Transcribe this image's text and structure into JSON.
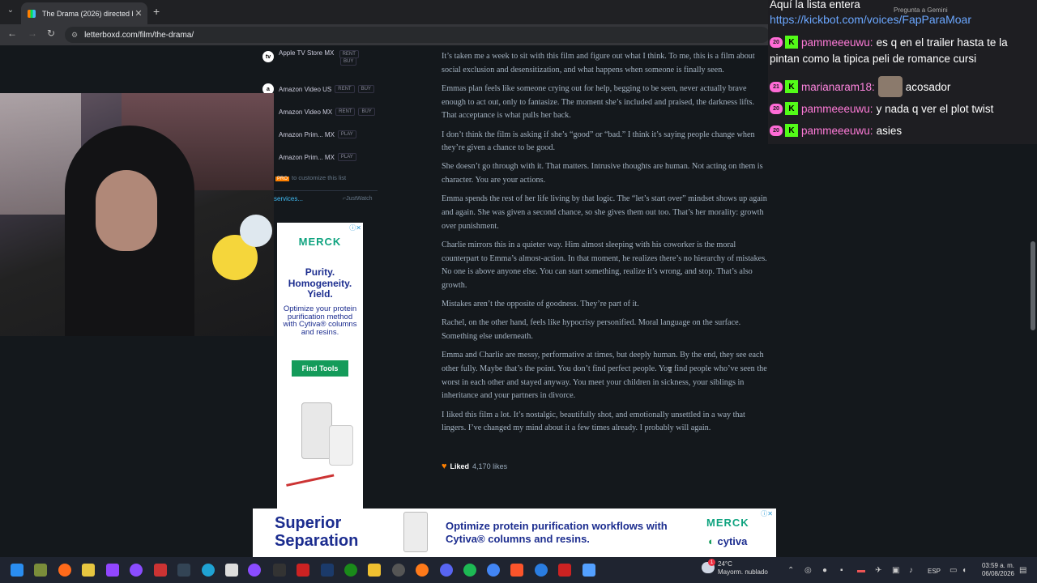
{
  "browser": {
    "tab_title": "The Drama (2026) directed by K",
    "tab_close": "✕",
    "new_tab": "+",
    "url": "letterboxd.com/film/the-drama/"
  },
  "where_to_watch": {
    "services": [
      {
        "name": "Apple TV Store MX",
        "icon": "tv",
        "badges": [
          "RENT",
          "BUY"
        ]
      },
      {
        "name": "Amazon Video US",
        "icon": "a",
        "badges": [
          "RENT",
          "BUY"
        ]
      },
      {
        "name": "Amazon Video MX",
        "icon": "a",
        "badges": [
          "RENT",
          "BUY"
        ]
      },
      {
        "name": "Amazon Prim... MX",
        "icon": "p",
        "badges": [
          "PLAY"
        ]
      },
      {
        "name": "Amazon Prim... MX",
        "icon": "p",
        "badges": [
          "PLAY"
        ]
      }
    ],
    "pro_badge": "PRO",
    "customize": "to customize this list",
    "services_link": "services...",
    "justwatch": "⌐JustWatch"
  },
  "review": {
    "paragraphs": [
      "It’s taken me a week to sit with this film and figure out what I think. To me, this is a film about social exclusion and desensitization, and what happens when someone is finally seen.",
      "Emmas plan feels like someone crying out for help, begging to be seen, never actually brave enough to act out, only to fantasize. The moment she’s included and praised, the darkness lifts. That acceptance is what pulls her back.",
      "I don’t think the film is asking if she’s “good” or “bad.” I think it’s saying people change when they’re given a chance to be good.",
      "She doesn’t go through with it. That matters. Intrusive thoughts are human. Not acting on them is character. You are your actions.",
      "Emma spends the rest of her life living by that logic. The “let’s start over” mindset shows up again and again. She was given a second chance, so she gives them out too. That’s her morality: growth over punishment.",
      "Charlie mirrors this in a quieter way. Him almost sleeping with his coworker is the moral counterpart to Emma’s almost-action. In that moment, he realizes there’s no hierarchy of mistakes. No one is above anyone else. You can start something, realize it’s wrong, and stop. That’s also growth.",
      "Mistakes aren’t the opposite of goodness. They’re part of it.",
      "Rachel, on the other hand, feels like hypocrisy personified. Moral language on the surface. Something else underneath.",
      "Emma and Charlie are messy, performative at times, but deeply human. By the end, they see each other fully. Maybe that’s the point. You don’t find perfect people. You find people who’ve seen the worst in each other and stayed anyway. You meet your children in sickness, your siblings in inheritance and your partners in divorce.",
      "I liked this film a lot. It’s nostalgic, beautifully shot, and emotionally unsettled in a way that lingers. I’ve changed my mind about it a few times already. I probably will again."
    ],
    "liked_label": "Liked",
    "likes_count": "4,170 likes"
  },
  "ad_vertical": {
    "brand": "MERCK",
    "headline": "Purity. Homogeneity. Yield.",
    "body": "Optimize your protein purification method with Cytiva® columns and resins.",
    "cta": "Find Tools"
  },
  "ad_banner": {
    "headline": "Superior Separation",
    "body": "Optimize protein purification workflows with Cytiva® columns and resins.",
    "brand": "MERCK",
    "brand2": "cytiva"
  },
  "chat": {
    "header": "Aquí la lista entera",
    "link": "https://kickbot.com/voices/FapParaMoar",
    "gemini": "Pregunta a Gemini",
    "messages": [
      {
        "level": "20",
        "user": "pammeeeuwu:",
        "text": "es q en el trailer hasta te la"
      },
      {
        "level": "",
        "user": "",
        "text": "pintan como la tipica peli de romance cursi"
      },
      {
        "level": "21",
        "user": "marianaram18:",
        "text": "acosador"
      },
      {
        "level": "20",
        "user": "pammeeeuwu:",
        "text": "y nada q ver el plot twist"
      },
      {
        "level": "20",
        "user": "pammeeeuwu:",
        "text": "asies"
      }
    ]
  },
  "taskbar": {
    "weather_temp": "24°C",
    "weather_desc": "Mayorm. nublado",
    "notification_count": "1",
    "language": "ESP",
    "time": "03:59 a. m.",
    "date": "06/08/2026"
  },
  "colors": {
    "page_bg": "#14181c",
    "letterboxd_orange": "#ff8000",
    "merck_green": "#0fa37f",
    "cytiva_blue": "#1c2d8f",
    "kick_green": "#53fc18"
  }
}
